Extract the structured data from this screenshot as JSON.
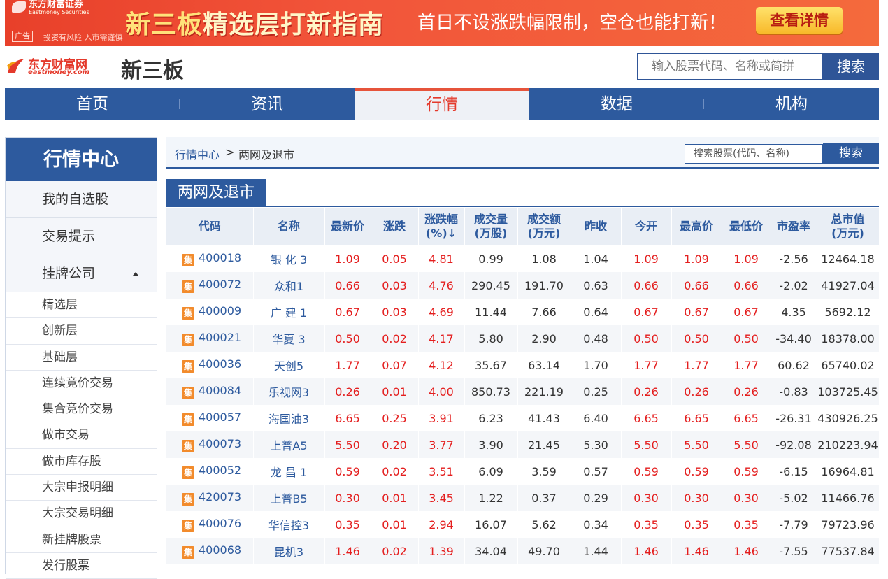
{
  "ad": {
    "brand": "东方财富证券",
    "brand_sub": "Eastmoney Securities",
    "title_a": "新三板",
    "title_b": "精选层打新指南",
    "subtitle": "首日不设涨跌幅限制，空仓也能打新！",
    "cta": "查看详情",
    "tag": "广告",
    "risk": "投资有风险 入市需谨慎"
  },
  "header": {
    "logo_text": "东方财富网",
    "logo_sub": "eastmoney.com",
    "site_name": "新三板",
    "search_placeholder": "输入股票代码、名称或简拼",
    "search_button": "搜索"
  },
  "nav": [
    {
      "label": "首页",
      "active": false
    },
    {
      "label": "资讯",
      "active": false
    },
    {
      "label": "行情",
      "active": true
    },
    {
      "label": "数据",
      "active": false
    },
    {
      "label": "机构",
      "active": false
    }
  ],
  "sidebar": {
    "title": "行情中心",
    "top_items": [
      "我的自选股",
      "交易提示"
    ],
    "group_title": "挂牌公司",
    "sub_items": [
      "精选层",
      "创新层",
      "基础层",
      "连续竞价交易",
      "集合竞价交易",
      "做市交易",
      "做市库存股",
      "大宗申报明细",
      "大宗交易明细",
      "新挂牌股票",
      "发行股票"
    ]
  },
  "breadcrumb": {
    "root": "行情中心",
    "separator": ">",
    "current": "两网及退市",
    "search_placeholder": "搜索股票(代码、名称)",
    "search_button": "搜索"
  },
  "section_title": "两网及退市",
  "table": {
    "badge": "集",
    "headers": [
      "代码",
      "名称",
      "最新价",
      "涨跌",
      "涨跌幅\n(%)↓",
      "成交量\n(万股)",
      "成交额\n(万元)",
      "昨收",
      "今开",
      "最高价",
      "最低价",
      "市盈率",
      "总市值\n(万元)"
    ],
    "rows": [
      [
        "400018",
        "银 化 3",
        "1.09",
        "0.05",
        "4.81",
        "0.99",
        "1.08",
        "1.04",
        "1.09",
        "1.09",
        "1.09",
        "-2.56",
        "12464.18"
      ],
      [
        "400072",
        "众和1",
        "0.66",
        "0.03",
        "4.76",
        "290.45",
        "191.70",
        "0.63",
        "0.66",
        "0.66",
        "0.66",
        "-2.02",
        "41927.04"
      ],
      [
        "400009",
        "广 建 1",
        "0.67",
        "0.03",
        "4.69",
        "11.44",
        "7.66",
        "0.64",
        "0.67",
        "0.67",
        "0.67",
        "4.35",
        "5692.12"
      ],
      [
        "400021",
        "华夏 3",
        "0.50",
        "0.02",
        "4.17",
        "5.80",
        "2.90",
        "0.48",
        "0.50",
        "0.50",
        "0.50",
        "-34.40",
        "18378.00"
      ],
      [
        "400036",
        "天创5",
        "1.77",
        "0.07",
        "4.12",
        "35.67",
        "63.14",
        "1.70",
        "1.77",
        "1.77",
        "1.77",
        "60.62",
        "65740.02"
      ],
      [
        "400084",
        "乐视网3",
        "0.26",
        "0.01",
        "4.00",
        "850.73",
        "221.19",
        "0.25",
        "0.26",
        "0.26",
        "0.26",
        "-0.83",
        "103725.45"
      ],
      [
        "400057",
        "海国油3",
        "6.65",
        "0.25",
        "3.91",
        "6.23",
        "41.43",
        "6.40",
        "6.65",
        "6.65",
        "6.65",
        "-26.31",
        "430926.25"
      ],
      [
        "400073",
        "上普A5",
        "5.50",
        "0.20",
        "3.77",
        "3.90",
        "21.45",
        "5.30",
        "5.50",
        "5.50",
        "5.50",
        "-92.08",
        "210223.94"
      ],
      [
        "400052",
        "龙 昌 1",
        "0.59",
        "0.02",
        "3.51",
        "6.09",
        "3.59",
        "0.57",
        "0.59",
        "0.59",
        "0.59",
        "-6.15",
        "16964.81"
      ],
      [
        "420073",
        "上普B5",
        "0.30",
        "0.01",
        "3.45",
        "1.22",
        "0.37",
        "0.29",
        "0.30",
        "0.30",
        "0.30",
        "-5.02",
        "11466.76"
      ],
      [
        "400076",
        "华信控3",
        "0.35",
        "0.01",
        "2.94",
        "16.07",
        "5.62",
        "0.34",
        "0.35",
        "0.35",
        "0.35",
        "-7.79",
        "79723.96"
      ],
      [
        "400068",
        "昆机3",
        "1.46",
        "0.02",
        "1.39",
        "34.04",
        "49.70",
        "1.44",
        "1.46",
        "1.46",
        "1.46",
        "-7.55",
        "77537.84"
      ]
    ]
  },
  "colors": {
    "primary_blue": "#2d5a9e",
    "up_red": "#e41e1e",
    "accent_orange": "#e6543b"
  }
}
